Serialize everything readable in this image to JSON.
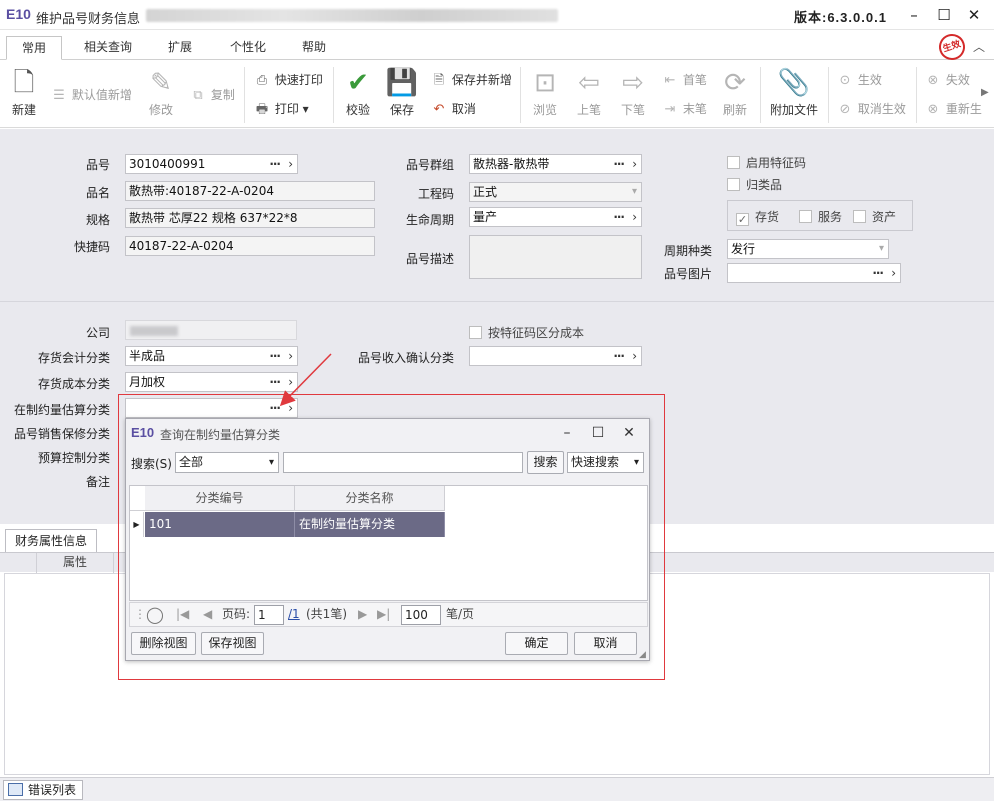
{
  "app": {
    "logo": "E10",
    "title": "维护品号财务信息",
    "version": "版本:6.3.0.0.1",
    "status_stamp": "生效"
  },
  "window": {
    "minimize": "–",
    "maximize": "☐",
    "close": "✕"
  },
  "tabs": [
    "常用",
    "相关查询",
    "扩展",
    "个性化",
    "帮助"
  ],
  "toolbar": {
    "new": "新建",
    "default_new": "默认值新增",
    "modify": "修改",
    "copy": "复制",
    "quick_print": "快速打印",
    "print": "打印",
    "verify": "校验",
    "save": "保存",
    "save_and_new": "保存并新增",
    "cancel": "取消",
    "browse": "浏览",
    "prev": "上笔",
    "next": "下笔",
    "first": "首笔",
    "last": "末笔",
    "refresh": "刷新",
    "attach": "附加文件",
    "activate": "生效",
    "cancel_activate": "取消生效",
    "invalidate": "失效",
    "regenerate": "重新生"
  },
  "form": {
    "item_no": {
      "label": "品号",
      "value": "3010400991"
    },
    "item_name": {
      "label": "品名",
      "value": "散热带:40187-22-A-0204"
    },
    "spec": {
      "label": "规格",
      "value": "散热带 芯厚22 规格 637*22*8"
    },
    "quick_code": {
      "label": "快捷码",
      "value": "40187-22-A-0204"
    },
    "item_group": {
      "label": "品号群组",
      "value": "散热器-散热带"
    },
    "eng_code": {
      "label": "工程码",
      "value": "正式"
    },
    "lifecycle": {
      "label": "生命周期",
      "value": "量产"
    },
    "item_desc": {
      "label": "品号描述",
      "value": ""
    },
    "enable_feature": "启用特征码",
    "class_item": "归类品",
    "inventory": "存货",
    "service": "服务",
    "asset": "资产",
    "cycle_type": {
      "label": "周期种类",
      "value": "发行"
    },
    "item_image": {
      "label": "品号图片",
      "value": ""
    },
    "company": {
      "label": "公司"
    },
    "cost_by_feature": "按特征码区分成本",
    "inv_acct_class": {
      "label": "存货会计分类",
      "value": "半成品"
    },
    "inv_cost_class": {
      "label": "存货成本分类",
      "value": "月加权"
    },
    "wip_class": {
      "label": "在制约量估算分类",
      "value": ""
    },
    "warranty_class": {
      "label": "品号销售保修分类"
    },
    "budget_class": {
      "label": "预算控制分类"
    },
    "remark": {
      "label": "备注"
    },
    "revenue_class": {
      "label": "品号收入确认分类",
      "value": ""
    }
  },
  "finance_tab": {
    "label": "财务属性信息",
    "column": "属性"
  },
  "status": {
    "error_list": "错误列表"
  },
  "dialog": {
    "logo": "E10",
    "title": "查询在制约量估算分类",
    "search_label": "搜索(S)",
    "search_scope": "全部",
    "search_value": "",
    "search_button": "搜索",
    "quick_search": "快速搜索",
    "columns": [
      "分类编号",
      "分类名称"
    ],
    "rows": [
      {
        "code": "101",
        "name": "在制约量估算分类"
      }
    ],
    "pager": {
      "page_label": "页码:",
      "page": "1",
      "total_pages": "/1",
      "total_records": "(共1笔)",
      "page_size": "100",
      "per_page": "笔/页"
    },
    "delete_view": "删除视图",
    "save_view": "保存视图",
    "confirm": "确定",
    "cancel": "取消"
  },
  "colors": {
    "accent_purple": "#5a4fa2",
    "highlight_red": "#e0393e",
    "selected_row": "#6b6a86"
  }
}
